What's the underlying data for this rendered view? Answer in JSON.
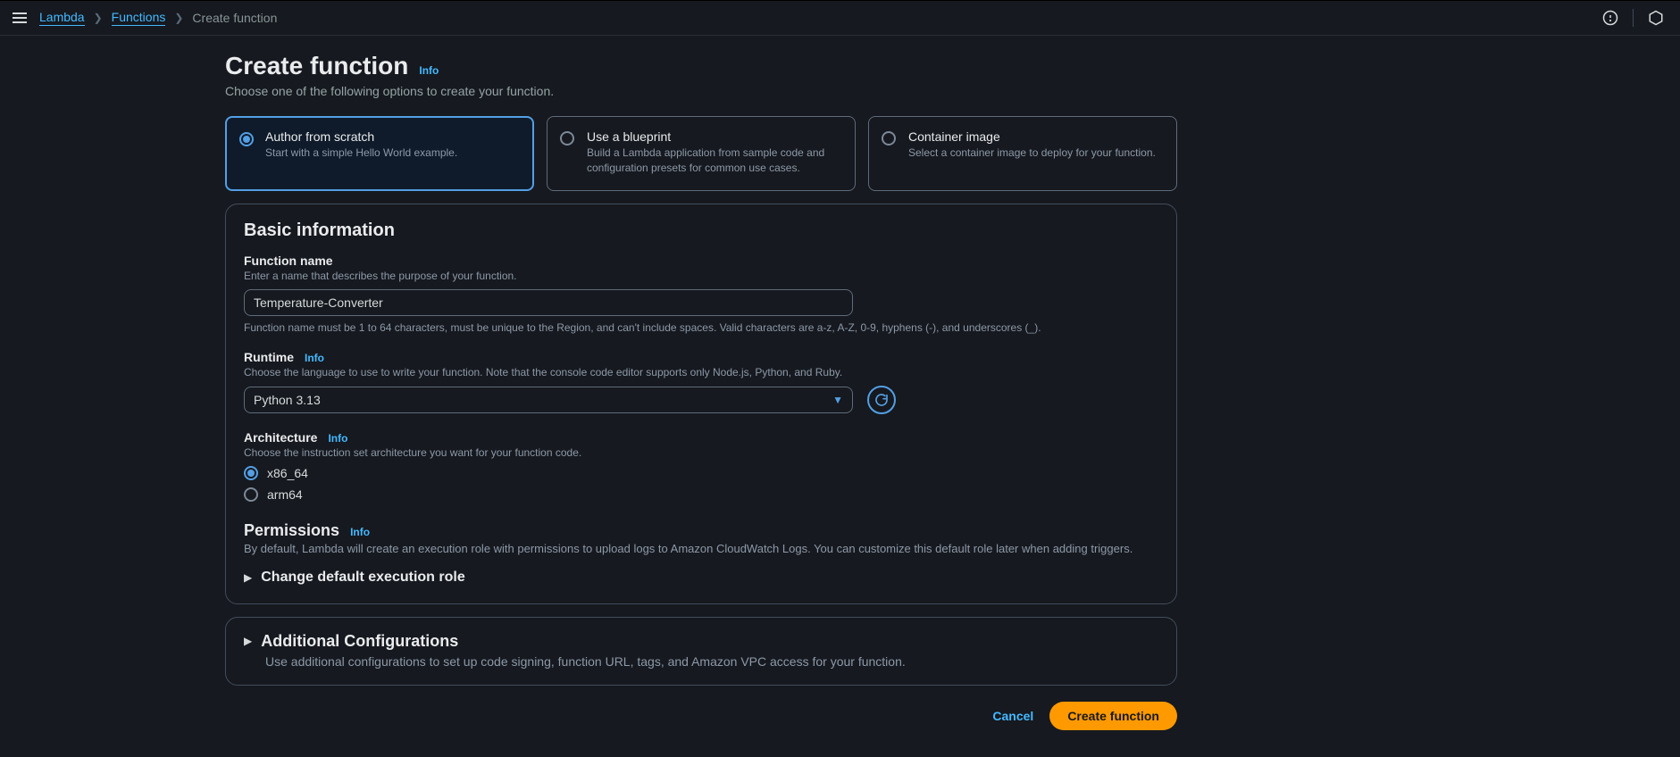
{
  "breadcrumbs": {
    "svc": "Lambda",
    "funcs": "Functions",
    "current": "Create function"
  },
  "page": {
    "title": "Create function",
    "info": "Info",
    "subtitle": "Choose one of the following options to create your function."
  },
  "options": {
    "scratch": {
      "title": "Author from scratch",
      "desc": "Start with a simple Hello World example."
    },
    "blueprint": {
      "title": "Use a blueprint",
      "desc": "Build a Lambda application from sample code and configuration presets for common use cases."
    },
    "container": {
      "title": "Container image",
      "desc": "Select a container image to deploy for your function."
    }
  },
  "basic": {
    "heading": "Basic information",
    "fn_label": "Function name",
    "fn_hint": "Enter a name that describes the purpose of your function.",
    "fn_value": "Temperature-Converter",
    "fn_constraint": "Function name must be 1 to 64 characters, must be unique to the Region, and can't include spaces. Valid characters are a-z, A-Z, 0-9, hyphens (-), and underscores (_).",
    "runtime_label": "Runtime",
    "runtime_info": "Info",
    "runtime_hint": "Choose the language to use to write your function. Note that the console code editor supports only Node.js, Python, and Ruby.",
    "runtime_value": "Python 3.13",
    "arch_label": "Architecture",
    "arch_info": "Info",
    "arch_hint": "Choose the instruction set architecture you want for your function code.",
    "arch_x86": "x86_64",
    "arch_arm": "arm64",
    "perm_title": "Permissions",
    "perm_info": "Info",
    "perm_desc": "By default, Lambda will create an execution role with permissions to upload logs to Amazon CloudWatch Logs. You can customize this default role later when adding triggers.",
    "change_role": "Change default execution role"
  },
  "additional": {
    "title": "Additional Configurations",
    "desc": "Use additional configurations to set up code signing, function URL, tags, and Amazon VPC access for your function."
  },
  "actions": {
    "cancel": "Cancel",
    "create": "Create function"
  }
}
